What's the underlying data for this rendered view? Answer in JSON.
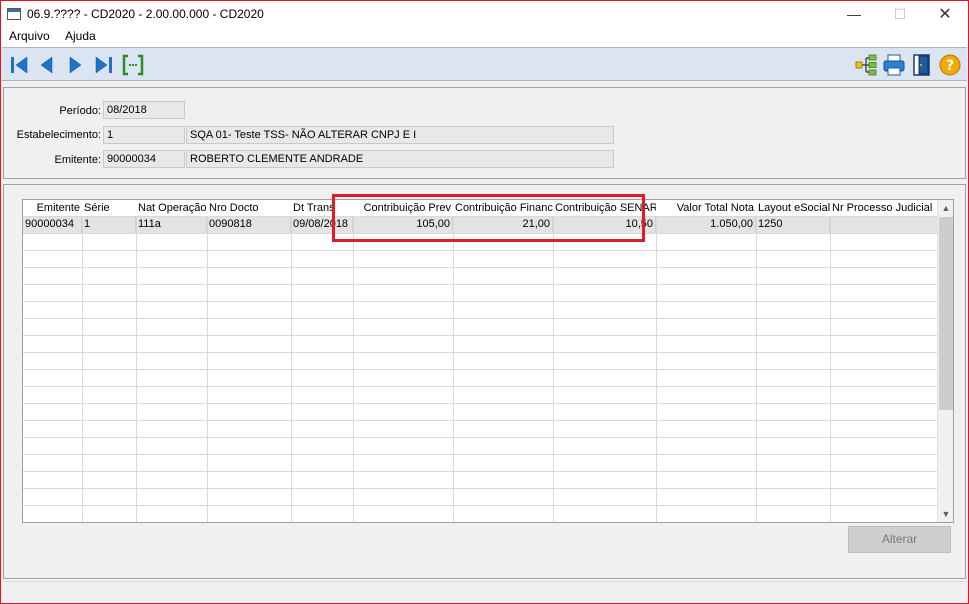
{
  "window": {
    "title": "06.9.???? - CD2020 - 2.00.00.000 - CD2020",
    "minimize": "—",
    "maximize": "☐",
    "close": "✕"
  },
  "menu": [
    {
      "label": "Arquivo"
    },
    {
      "label": "Ajuda"
    }
  ],
  "toolbar": {
    "buttons": [
      "first-record",
      "previous-record",
      "next-record",
      "last-record",
      "go-to-record",
      "tree-view",
      "print",
      "exit",
      "help"
    ]
  },
  "header": {
    "periodo_label": "Período:",
    "periodo_value": "08/2018",
    "estabelecimento_label": "Estabelecimento:",
    "estabelecimento_code": "1",
    "estabelecimento_name": "SQA 01- Teste TSS-  NÃO ALTERAR CNPJ E I",
    "emitente_label": "Emitente:",
    "emitente_code": "90000034",
    "emitente_name": "ROBERTO CLEMENTE ANDRADE"
  },
  "grid": {
    "columns": [
      "Emitente",
      "Série",
      "Nat Operação",
      "Nro Docto",
      "Dt Trans",
      "Contribuição Prev",
      "Contribuição Financ",
      "Contribuição SENAR",
      "Valor Total Nota",
      "Layout eSocial",
      "Nr Processo Judicial"
    ],
    "rows": [
      [
        "90000034",
        "1",
        "111a",
        "0090818",
        "09/08/2018",
        "105,00",
        "21,00",
        "10,50",
        "1.050,00",
        "1250",
        ""
      ]
    ]
  },
  "actions": {
    "alterar_label": "Alterar"
  },
  "colors": {
    "highlight": "#e01c24",
    "toolbar_bg": "#dbe5f1",
    "icon_blue": "#1e73c8"
  }
}
